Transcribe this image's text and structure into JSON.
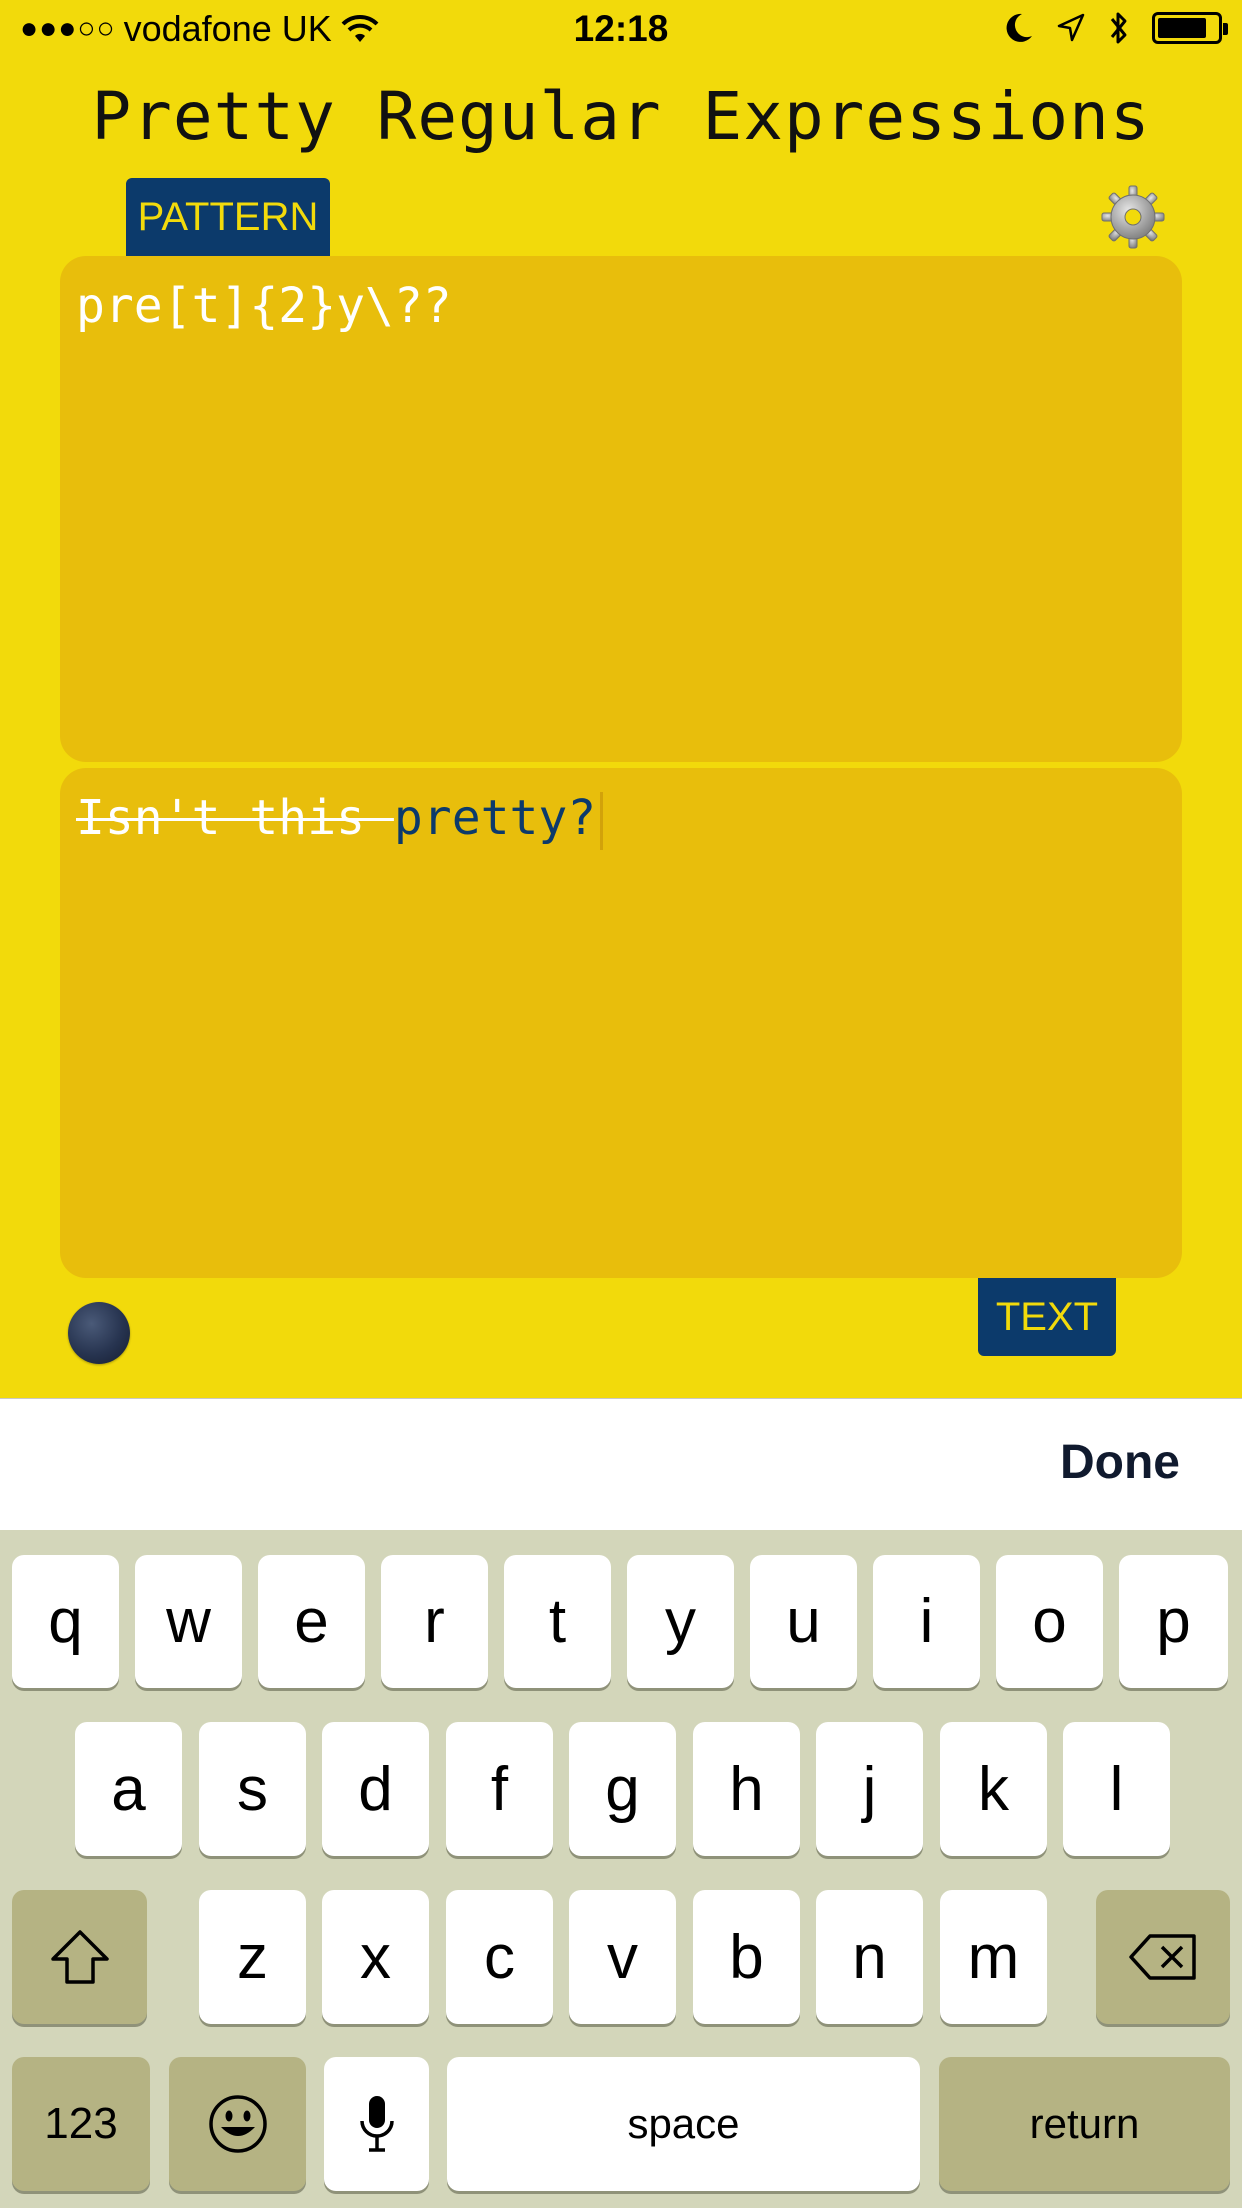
{
  "status_bar": {
    "signal": "●●●○○",
    "carrier": "vodafone UK",
    "time": "12:18",
    "battery_level": 0.84
  },
  "app": {
    "title": "Pretty Regular Expressions",
    "pattern_tab": "PATTERN",
    "text_tab": "TEXT",
    "pattern_value": "pre[t]{2}y\\??",
    "text_unmatched": "Isn't this ",
    "text_matched": "pretty?"
  },
  "colors": {
    "background": "#f2da0b",
    "panel": "#e8be0c",
    "accent": "#0c3a6b"
  },
  "accessory": {
    "done_label": "Done"
  },
  "keyboard": {
    "row1": [
      "q",
      "w",
      "e",
      "r",
      "t",
      "y",
      "u",
      "i",
      "o",
      "p"
    ],
    "row2": [
      "a",
      "s",
      "d",
      "f",
      "g",
      "h",
      "j",
      "k",
      "l"
    ],
    "row3": [
      "z",
      "x",
      "c",
      "v",
      "b",
      "n",
      "m"
    ],
    "numbers_label": "123",
    "space_label": "space",
    "return_label": "return"
  }
}
